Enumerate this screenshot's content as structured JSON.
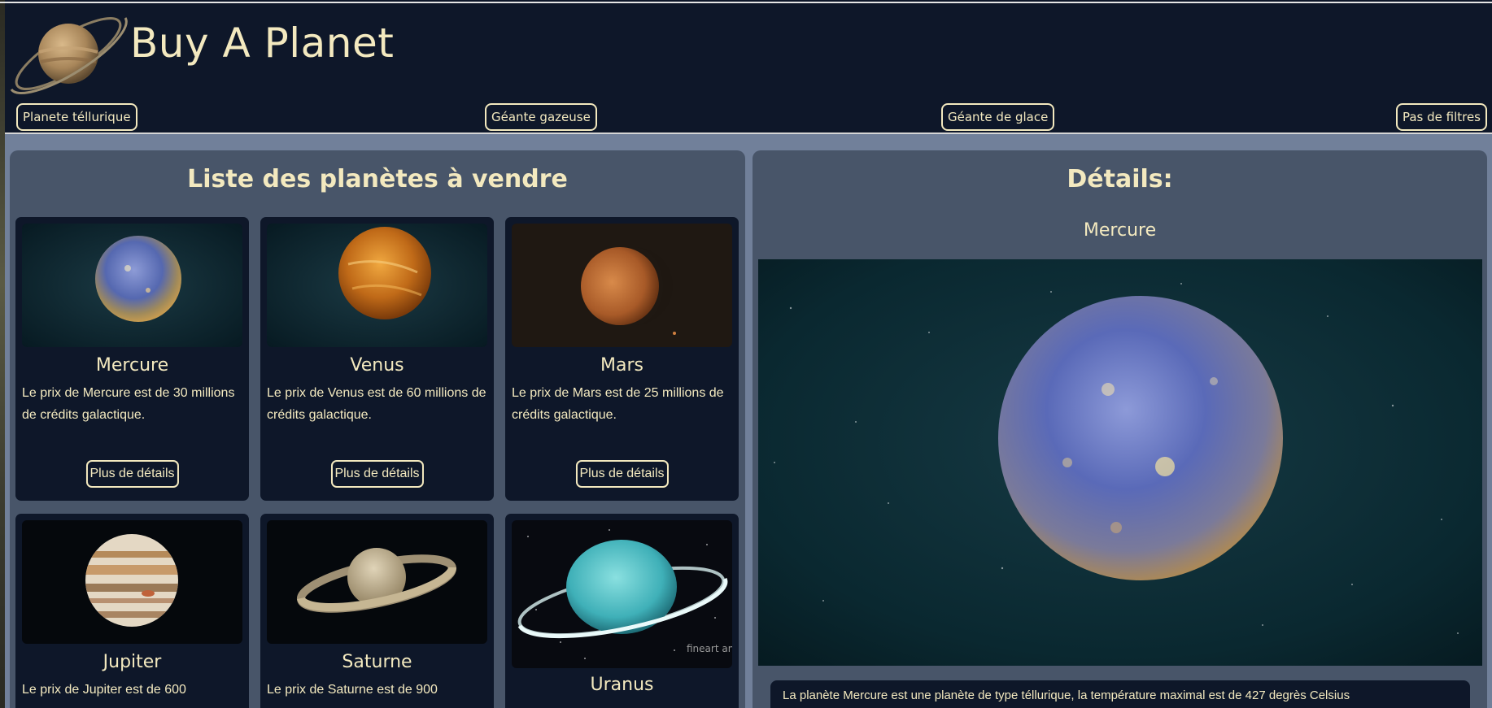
{
  "header": {
    "title": "Buy A Planet",
    "logo_icon": "saturn-logo-icon"
  },
  "filters": [
    {
      "label": "Planete téllurique"
    },
    {
      "label": "Géante gazeuse"
    },
    {
      "label": "Géante de glace"
    },
    {
      "label": "Pas de filtres"
    }
  ],
  "list_panel": {
    "title": "Liste des planètes à vendre",
    "cards": [
      {
        "name": "Mercure",
        "desc": "Le prix de Mercure est de 30 millions de crédits galactique.",
        "button": "Plus de détails"
      },
      {
        "name": "Venus",
        "desc": "Le prix de Venus est de 60 millions de crédits galactique.",
        "button": "Plus de détails"
      },
      {
        "name": "Mars",
        "desc": "Le prix de Mars est de 25 millions de crédits galactique.",
        "button": "Plus de détails"
      },
      {
        "name": "Jupiter",
        "desc": "Le prix de Jupiter est de 600"
      },
      {
        "name": "Saturne",
        "desc": "Le prix de Saturne est de 900"
      },
      {
        "name": "Uranus",
        "watermark": "fineart america"
      }
    ]
  },
  "detail_panel": {
    "title": "Détails:",
    "planet_name": "Mercure",
    "description": "La planète Mercure est une planète de type téllurique, la température maximal est de 427 degrès Celsius"
  },
  "colors": {
    "accent": "#f3e9bf",
    "panel": "#485569",
    "card": "#0e1729",
    "page_bg": "#71809a"
  }
}
